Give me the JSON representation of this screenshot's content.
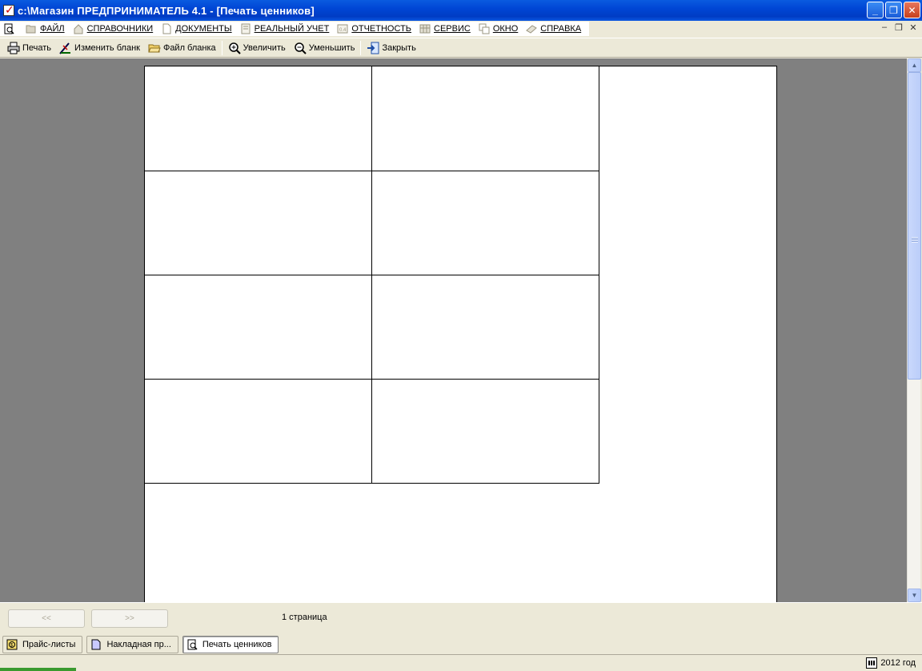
{
  "window": {
    "title": "c:\\Магазин  ПРЕДПРИНИМАТЕЛЬ 4.1 - [Печать ценников]",
    "min_label": "_",
    "max_label": "❐",
    "close_label": "✕"
  },
  "menu": {
    "items": [
      {
        "label": "ФАЙЛ",
        "icon": "folder-open-icon"
      },
      {
        "label": "СПРАВОЧНИКИ",
        "icon": "house-icon"
      },
      {
        "label": "ДОКУМЕНТЫ",
        "icon": "document-icon"
      },
      {
        "label": "РЕАЛЬНЫЙ УЧЕТ",
        "icon": "ledger-icon"
      },
      {
        "label": "ОТЧЕТНОСТЬ",
        "icon": "report-icon"
      },
      {
        "label": "СЕРВИС",
        "icon": "calculator-icon"
      },
      {
        "label": "ОКНО",
        "icon": "windows-icon"
      },
      {
        "label": "СПРАВКА",
        "icon": "book-icon"
      }
    ],
    "mdi_min": "–",
    "mdi_restore": "❐",
    "mdi_close": "✕"
  },
  "toolbar": {
    "print": "Печать",
    "edit_form": "Изменить бланк",
    "form_file": "Файл бланка",
    "zoom_in": "Увеличить",
    "zoom_out": "Уменьшить",
    "close": "Закрыть"
  },
  "preview": {
    "label_rows": 4,
    "label_cols": 2
  },
  "navigation": {
    "prev": "<<",
    "next": ">>",
    "page_count": "1 страница"
  },
  "tasks": [
    {
      "label": "Прайс-листы",
      "icon": "price-list-icon",
      "active": false
    },
    {
      "label": "Накладная пр...",
      "icon": "invoice-icon",
      "active": false
    },
    {
      "label": "Печать ценников",
      "icon": "print-preview-icon",
      "active": true
    }
  ],
  "status": {
    "year": "2012 год"
  },
  "colors": {
    "titlebar": "#0046d5",
    "workspace": "#808080",
    "chrome": "#ece9d8"
  }
}
